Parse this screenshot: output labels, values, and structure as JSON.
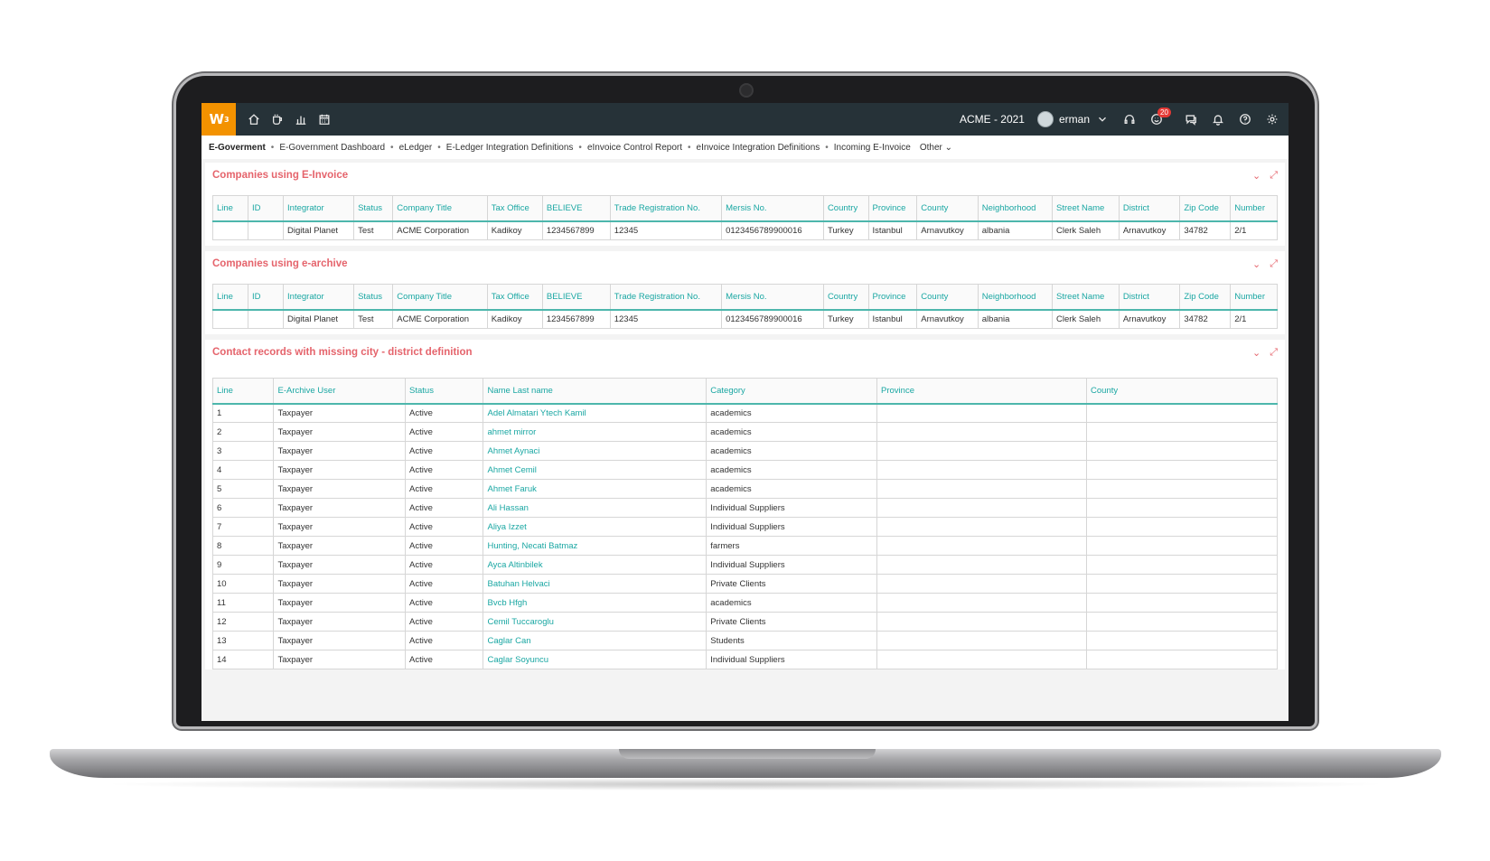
{
  "topbar": {
    "logo": "W",
    "logo_sup": "3",
    "company": "ACME - 2021",
    "user": "erman",
    "notification_count": "20",
    "nav_icons": [
      "home-icon",
      "coffee-icon",
      "bar-chart-icon",
      "calendar-icon"
    ],
    "right_icons": [
      "headset-icon",
      "smile-icon",
      "chat-icon",
      "bell-icon",
      "help-icon",
      "gear-icon"
    ]
  },
  "breadcrumb": {
    "first": "E-Goverment",
    "items": [
      "E-Government Dashboard",
      "eLedger",
      "E-Ledger Integration Definitions",
      "eInvoice Control Report",
      "eInvoice Integration Definitions",
      "Incoming E-Invoice"
    ],
    "other": "Other"
  },
  "einvoice": {
    "title": "Companies using E-Invoice",
    "headers": [
      "Line",
      "ID",
      "Integrator",
      "Status",
      "Company Title",
      "Tax Office",
      "BELIEVE",
      "Trade Registration No.",
      "Mersis No.",
      "Country",
      "Province",
      "County",
      "Neighborhood",
      "Street Name",
      "District",
      "Zip Code",
      "Number"
    ],
    "rows": [
      [
        "",
        "",
        "Digital Planet",
        "Test",
        "ACME Corporation",
        "Kadikoy",
        "1234567899",
        "12345",
        "0123456789900016",
        "Turkey",
        "Istanbul",
        "Arnavutkoy",
        "albania",
        "Clerk Saleh",
        "Arnavutkoy",
        "34782",
        "2/1"
      ]
    ]
  },
  "earchive": {
    "title": "Companies using e-archive",
    "headers": [
      "Line",
      "ID",
      "Integrator",
      "Status",
      "Company Title",
      "Tax Office",
      "BELIEVE",
      "Trade Registration No.",
      "Mersis No.",
      "Country",
      "Province",
      "County",
      "Neighborhood",
      "Street Name",
      "District",
      "Zip Code",
      "Number"
    ],
    "rows": [
      [
        "",
        "",
        "Digital Planet",
        "Test",
        "ACME Corporation",
        "Kadikoy",
        "1234567899",
        "12345",
        "0123456789900016",
        "Turkey",
        "Istanbul",
        "Arnavutkoy",
        "albania",
        "Clerk Saleh",
        "Arnavutkoy",
        "34782",
        "2/1"
      ]
    ]
  },
  "contacts": {
    "title": "Contact records with missing city - district definition",
    "headers": [
      "Line",
      "E-Archive User",
      "Status",
      "Name Last name",
      "Category",
      "Province",
      "County"
    ],
    "rows": [
      [
        "1",
        "Taxpayer",
        "Active",
        "Adel Almatari Ytech Kamil",
        "academics",
        "",
        ""
      ],
      [
        "2",
        "Taxpayer",
        "Active",
        "ahmet mirror",
        "academics",
        "",
        ""
      ],
      [
        "3",
        "Taxpayer",
        "Active",
        "Ahmet Aynaci",
        "academics",
        "",
        ""
      ],
      [
        "4",
        "Taxpayer",
        "Active",
        "Ahmet Cemil",
        "academics",
        "",
        ""
      ],
      [
        "5",
        "Taxpayer",
        "Active",
        "Ahmet Faruk",
        "academics",
        "",
        ""
      ],
      [
        "6",
        "Taxpayer",
        "Active",
        "Ali Hassan",
        "Individual Suppliers",
        "",
        ""
      ],
      [
        "7",
        "Taxpayer",
        "Active",
        "Aliya Izzet",
        "Individual Suppliers",
        "",
        ""
      ],
      [
        "8",
        "Taxpayer",
        "Active",
        "Hunting, Necati Batmaz",
        "farmers",
        "",
        ""
      ],
      [
        "9",
        "Taxpayer",
        "Active",
        "Ayca Altinbilek",
        "Individual Suppliers",
        "",
        ""
      ],
      [
        "10",
        "Taxpayer",
        "Active",
        "Batuhan Helvaci",
        "Private Clients",
        "",
        ""
      ],
      [
        "11",
        "Taxpayer",
        "Active",
        "Bvcb Hfgh",
        "academics",
        "",
        ""
      ],
      [
        "12",
        "Taxpayer",
        "Active",
        "Cemil Tuccaroglu",
        "Private Clients",
        "",
        ""
      ],
      [
        "13",
        "Taxpayer",
        "Active",
        "Caglar Can",
        "Students",
        "",
        ""
      ],
      [
        "14",
        "Taxpayer",
        "Active",
        "Caglar Soyuncu",
        "Individual Suppliers",
        "",
        ""
      ]
    ]
  },
  "colors": {
    "accent_teal": "#1aa7a3",
    "title_red": "#e5646c",
    "topbar": "#263238",
    "logo_orange": "#f39200"
  }
}
